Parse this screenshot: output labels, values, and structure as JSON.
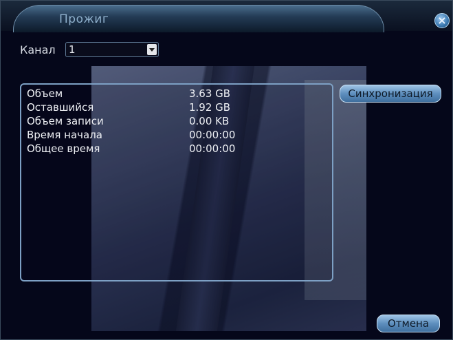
{
  "window": {
    "title": "Прожиг",
    "close_icon": "close-icon"
  },
  "channel": {
    "label": "Канал",
    "selected": "1"
  },
  "info": {
    "rows": [
      {
        "label": "Объем",
        "value": "3.63 GB"
      },
      {
        "label": "Оставшийся",
        "value": "1.92 GB"
      },
      {
        "label": "Объем записи",
        "value": "0.00 KB"
      },
      {
        "label": "Время начала",
        "value": "00:00:00"
      },
      {
        "label": "Общее время",
        "value": "00:00:00"
      }
    ]
  },
  "buttons": {
    "sync_label": "Синхронизация",
    "cancel_label": "Отмена"
  }
}
